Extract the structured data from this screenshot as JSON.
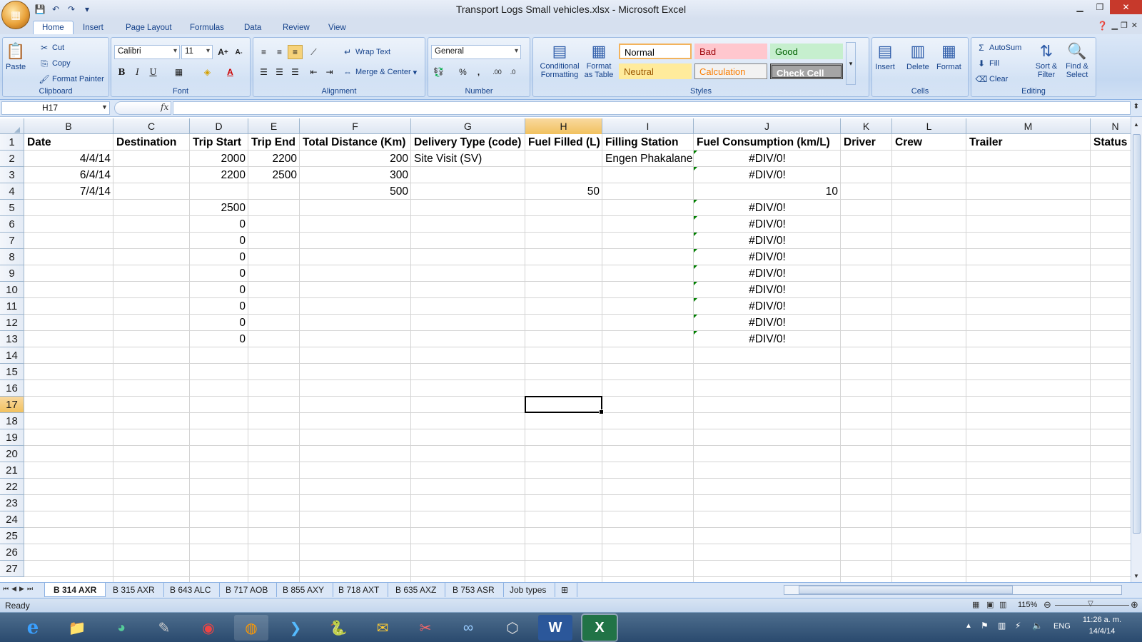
{
  "window": {
    "title": "Transport Logs Small vehicles.xlsx - Microsoft Excel"
  },
  "tabs": [
    "Home",
    "Insert",
    "Page Layout",
    "Formulas",
    "Data",
    "Review",
    "View"
  ],
  "ribbon": {
    "clipboard": {
      "label": "Clipboard",
      "paste": "Paste",
      "cut": "Cut",
      "copy": "Copy",
      "format_painter": "Format Painter"
    },
    "font": {
      "label": "Font",
      "name": "Calibri",
      "size": "11"
    },
    "alignment": {
      "label": "Alignment",
      "wrap_text": "Wrap Text",
      "merge_center": "Merge & Center"
    },
    "number": {
      "label": "Number",
      "format": "General"
    },
    "styles": {
      "label": "Styles",
      "conditional": "Conditional Formatting",
      "format_table": "Format as Table",
      "normal": "Normal",
      "bad": "Bad",
      "good": "Good",
      "neutral": "Neutral",
      "calculation": "Calculation",
      "check_cell": "Check Cell"
    },
    "cells": {
      "label": "Cells",
      "insert": "Insert",
      "delete": "Delete",
      "format": "Format"
    },
    "editing": {
      "label": "Editing",
      "autosum": "AutoSum",
      "fill": "Fill",
      "clear": "Clear",
      "sort_filter": "Sort & Filter",
      "find_select": "Find & Select"
    }
  },
  "formula_bar": {
    "name_box": "H17",
    "fx": "fx",
    "content": ""
  },
  "columns": [
    "B",
    "C",
    "D",
    "E",
    "F",
    "G",
    "H",
    "I",
    "J",
    "K",
    "L",
    "M",
    "N"
  ],
  "selected_column": "H",
  "selected_row": "17",
  "rows": [
    "1",
    "2",
    "3",
    "4",
    "5",
    "6",
    "7",
    "8",
    "9",
    "10",
    "11",
    "12",
    "13",
    "14",
    "15",
    "16",
    "17",
    "18",
    "19",
    "20",
    "21",
    "22",
    "23",
    "24",
    "25",
    "26",
    "27"
  ],
  "headers": [
    "Date",
    "Destination",
    "Trip Start",
    "Trip End",
    "Total Distance (Km)",
    "Delivery Type (code)",
    "Fuel Filled (L)",
    "Filling Station",
    "Fuel Consumption (km/L)",
    "Driver",
    "Crew",
    "Trailer",
    "Status"
  ],
  "data": [
    {
      "date": "4/4/14",
      "start": "2000",
      "end": "2200",
      "dist": "200",
      "type": "Site Visit (SV)",
      "fuel": "",
      "station": "Engen Phakalane",
      "cons": "#DIV/0!"
    },
    {
      "date": "6/4/14",
      "start": "2200",
      "end": "2500",
      "dist": "300",
      "type": "",
      "fuel": "",
      "station": "",
      "cons": "#DIV/0!"
    },
    {
      "date": "7/4/14",
      "start": "",
      "end": "",
      "dist": "500",
      "type": "",
      "fuel": "50",
      "station": "",
      "cons": "10"
    },
    {
      "date": "",
      "start": "2500",
      "end": "",
      "dist": "",
      "type": "",
      "fuel": "",
      "station": "",
      "cons": "#DIV/0!"
    },
    {
      "date": "",
      "start": "0",
      "end": "",
      "dist": "",
      "type": "",
      "fuel": "",
      "station": "",
      "cons": "#DIV/0!"
    },
    {
      "date": "",
      "start": "0",
      "end": "",
      "dist": "",
      "type": "",
      "fuel": "",
      "station": "",
      "cons": "#DIV/0!"
    },
    {
      "date": "",
      "start": "0",
      "end": "",
      "dist": "",
      "type": "",
      "fuel": "",
      "station": "",
      "cons": "#DIV/0!"
    },
    {
      "date": "",
      "start": "0",
      "end": "",
      "dist": "",
      "type": "",
      "fuel": "",
      "station": "",
      "cons": "#DIV/0!"
    },
    {
      "date": "",
      "start": "0",
      "end": "",
      "dist": "",
      "type": "",
      "fuel": "",
      "station": "",
      "cons": "#DIV/0!"
    },
    {
      "date": "",
      "start": "0",
      "end": "",
      "dist": "",
      "type": "",
      "fuel": "",
      "station": "",
      "cons": "#DIV/0!"
    },
    {
      "date": "",
      "start": "0",
      "end": "",
      "dist": "",
      "type": "",
      "fuel": "",
      "station": "",
      "cons": "#DIV/0!"
    },
    {
      "date": "",
      "start": "0",
      "end": "",
      "dist": "",
      "type": "",
      "fuel": "",
      "station": "",
      "cons": "#DIV/0!"
    }
  ],
  "sheet_tabs": [
    "B 314 AXR",
    "B 315 AXR",
    "B 643 ALC",
    "B 717 AOB",
    "B 855 AXY",
    "B 718 AXT",
    "B 635 AXZ",
    "B 753 ASR",
    "Job types"
  ],
  "active_sheet": "B 314 AXR",
  "status": {
    "ready": "Ready",
    "zoom": "115%"
  },
  "taskbar": {
    "lang": "ENG",
    "time": "11:26 a. m.",
    "date": "14/4/14"
  },
  "colors": {
    "accent": "#15428b",
    "selected_header": "#f1c15f",
    "error_marker": "#008000",
    "close": "#c7392b"
  }
}
